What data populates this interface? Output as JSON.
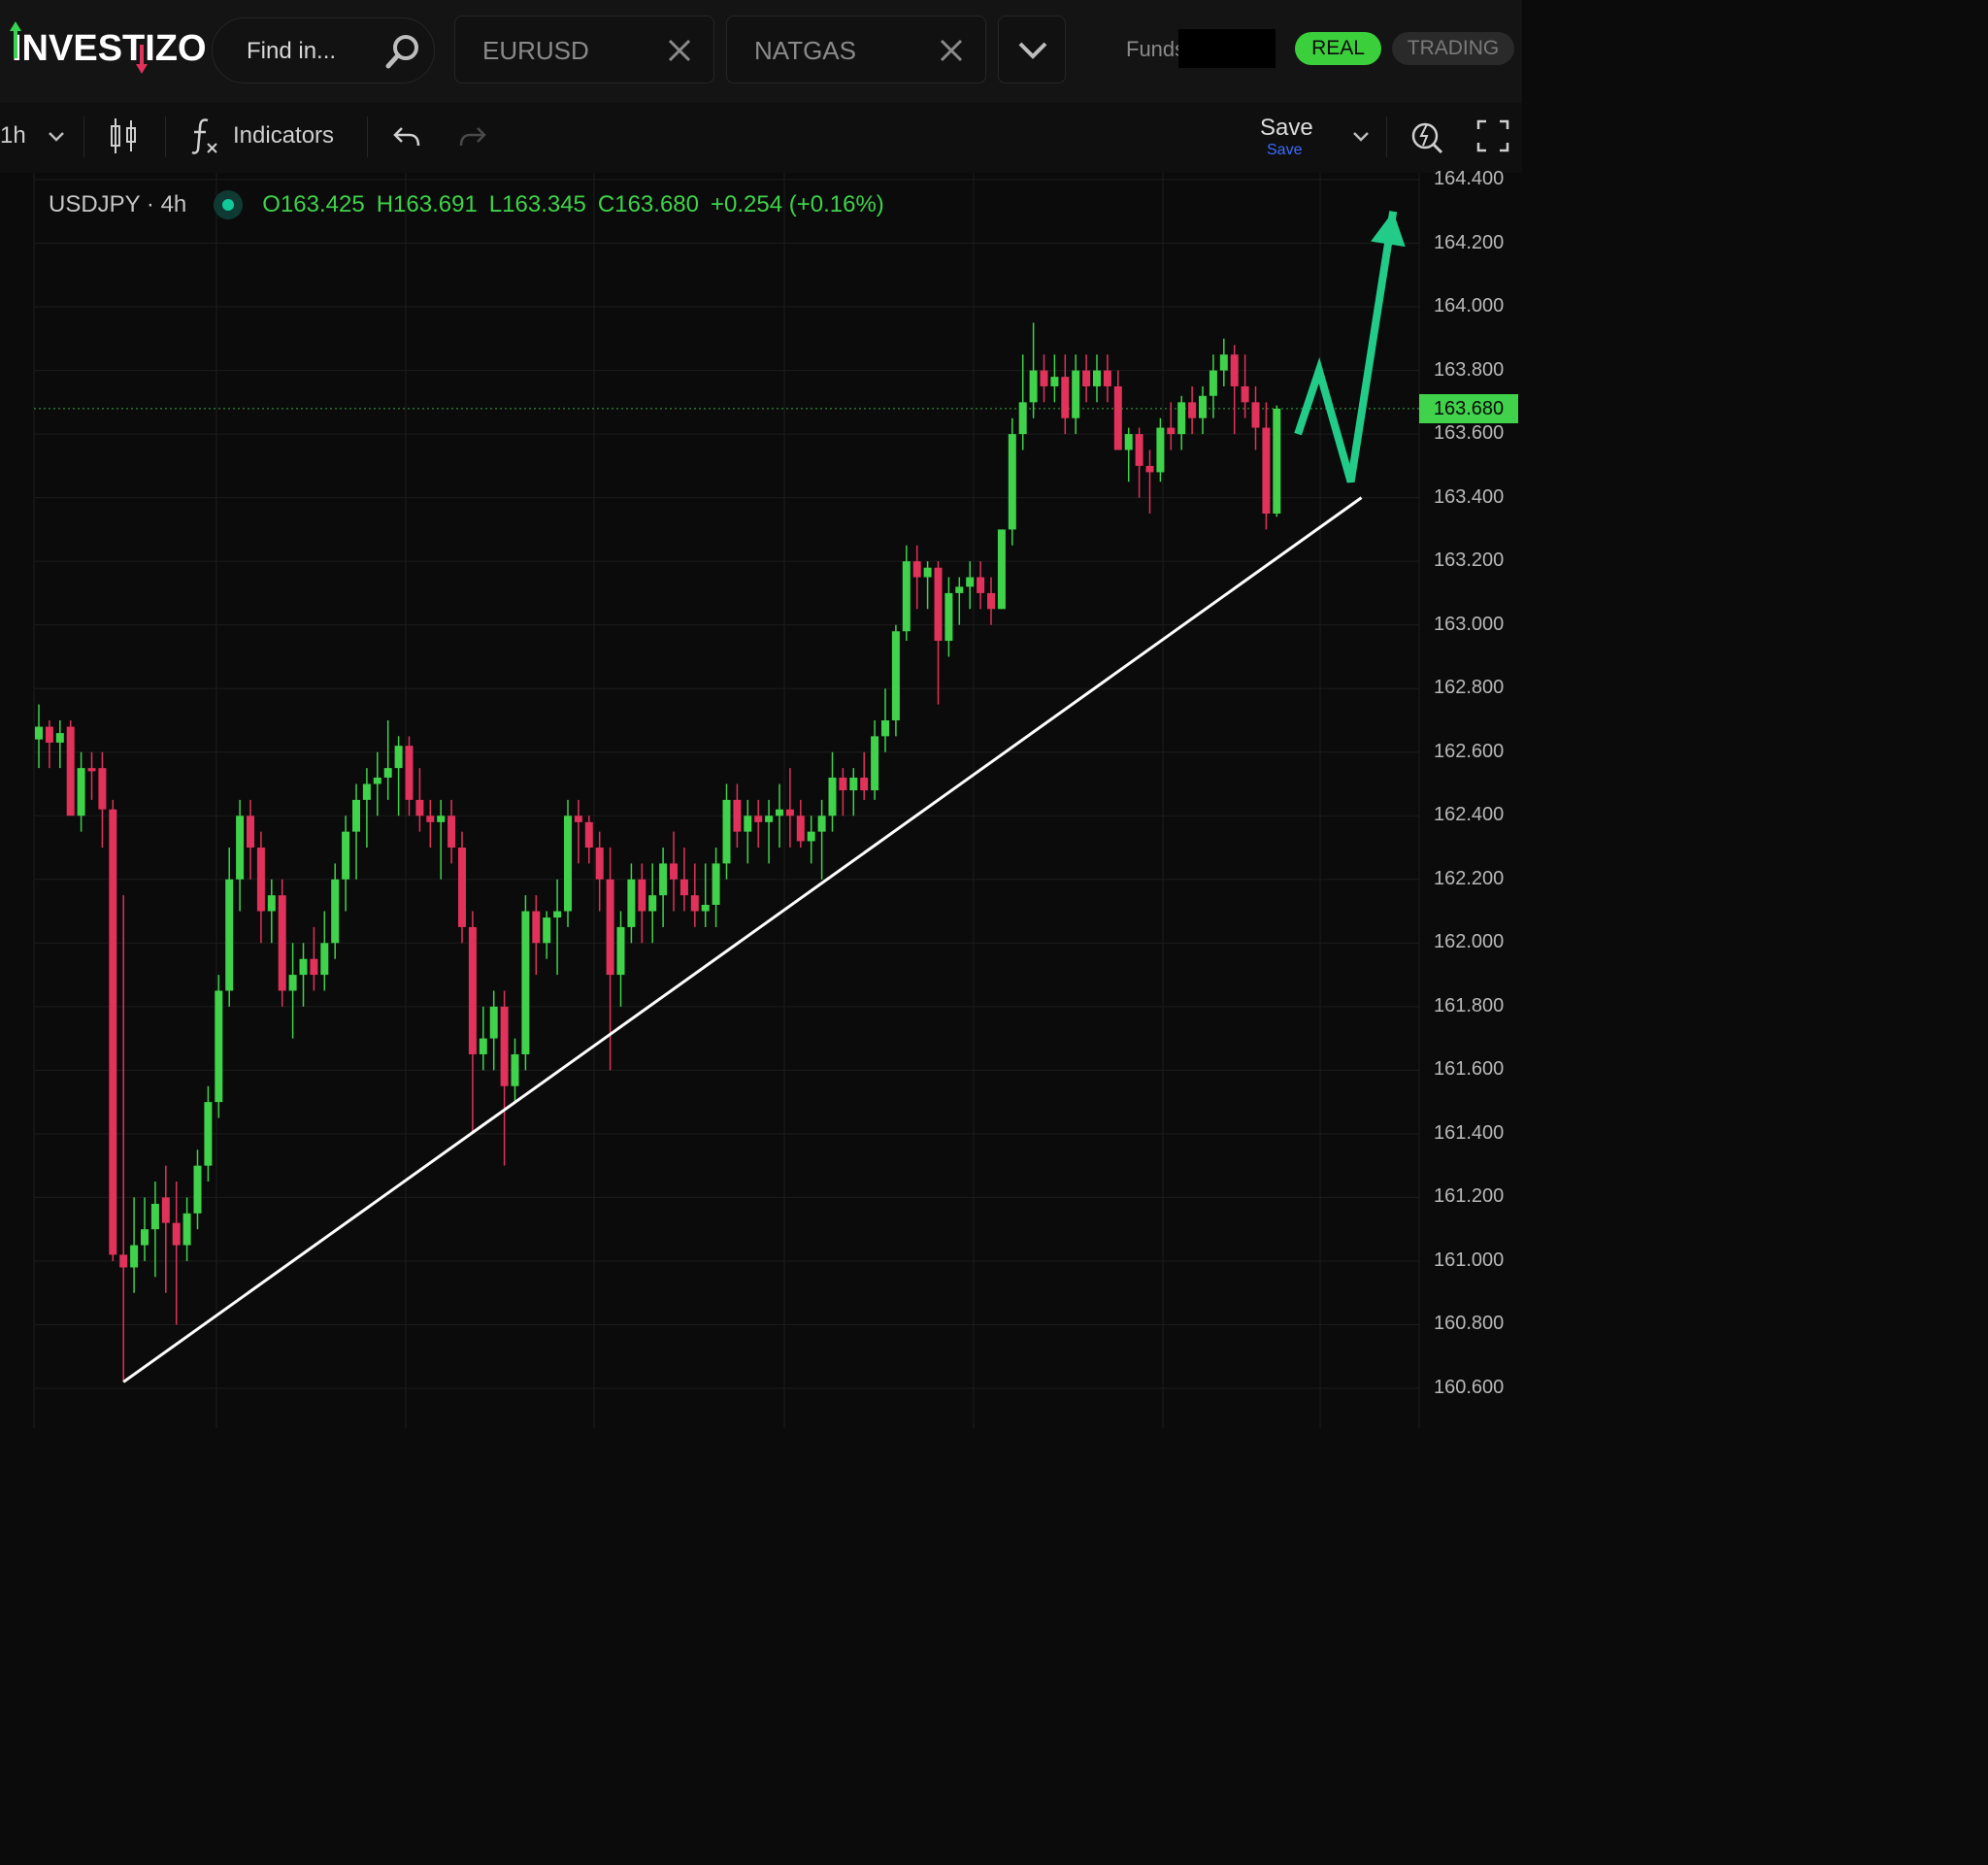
{
  "header": {
    "logo_text": "INVESTIZO",
    "search_placeholder": "Find in...",
    "tabs": [
      {
        "label": "EURUSD"
      },
      {
        "label": "NATGAS"
      }
    ],
    "funds_label": "Funds",
    "mode_real": "REAL",
    "mode_trading": "TRADING"
  },
  "toolbar": {
    "interval": "1h",
    "indicators_label": "Indicators",
    "save_label": "Save",
    "save_sub_label": "Save"
  },
  "legend": {
    "symbol": "USDJPY · 4h",
    "open": "O163.425",
    "high": "H163.691",
    "low": "L163.345",
    "close": "C163.680",
    "change": "+0.254 (+0.16%)"
  },
  "current_price": "163.680",
  "colors": {
    "up": "#3fd24a",
    "down": "#e0325a",
    "accent_green": "#3ccf3c",
    "arrow": "#22cc88",
    "trendline": "#ffffff",
    "link_blue": "#3b6cff"
  },
  "chart_data": {
    "type": "candlestick",
    "ylim": [
      160.5,
      164.4
    ],
    "y_ticks": [
      "164.400",
      "164.200",
      "164.000",
      "163.800",
      "163.600",
      "163.400",
      "163.200",
      "163.000",
      "162.800",
      "162.600",
      "162.400",
      "162.200",
      "162.000",
      "161.800",
      "161.600",
      "161.400",
      "161.200",
      "161.000",
      "160.800",
      "160.600"
    ],
    "current_price": 163.68,
    "candles": [
      {
        "o": 162.64,
        "h": 162.75,
        "l": 162.55,
        "c": 162.68
      },
      {
        "o": 162.68,
        "h": 162.7,
        "l": 162.55,
        "c": 162.63
      },
      {
        "o": 162.63,
        "h": 162.7,
        "l": 162.55,
        "c": 162.66
      },
      {
        "o": 162.68,
        "h": 162.7,
        "l": 162.5,
        "c": 162.4
      },
      {
        "o": 162.4,
        "h": 162.6,
        "l": 162.35,
        "c": 162.55
      },
      {
        "o": 162.55,
        "h": 162.6,
        "l": 162.45,
        "c": 162.54
      },
      {
        "o": 162.55,
        "h": 162.6,
        "l": 162.3,
        "c": 162.42
      },
      {
        "o": 162.42,
        "h": 162.45,
        "l": 161.0,
        "c": 161.02
      },
      {
        "o": 161.02,
        "h": 162.15,
        "l": 160.62,
        "c": 160.98
      },
      {
        "o": 160.98,
        "h": 161.2,
        "l": 160.9,
        "c": 161.05
      },
      {
        "o": 161.05,
        "h": 161.2,
        "l": 161.0,
        "c": 161.1
      },
      {
        "o": 161.1,
        "h": 161.25,
        "l": 160.95,
        "c": 161.18
      },
      {
        "o": 161.2,
        "h": 161.3,
        "l": 160.9,
        "c": 161.12
      },
      {
        "o": 161.12,
        "h": 161.25,
        "l": 160.8,
        "c": 161.05
      },
      {
        "o": 161.05,
        "h": 161.2,
        "l": 161.0,
        "c": 161.15
      },
      {
        "o": 161.15,
        "h": 161.35,
        "l": 161.1,
        "c": 161.3
      },
      {
        "o": 161.3,
        "h": 161.55,
        "l": 161.25,
        "c": 161.5
      },
      {
        "o": 161.5,
        "h": 161.9,
        "l": 161.45,
        "c": 161.85
      },
      {
        "o": 161.85,
        "h": 162.3,
        "l": 161.8,
        "c": 162.2
      },
      {
        "o": 162.2,
        "h": 162.45,
        "l": 162.1,
        "c": 162.4
      },
      {
        "o": 162.4,
        "h": 162.45,
        "l": 162.2,
        "c": 162.3
      },
      {
        "o": 162.3,
        "h": 162.35,
        "l": 162.0,
        "c": 162.1
      },
      {
        "o": 162.1,
        "h": 162.2,
        "l": 162.0,
        "c": 162.15
      },
      {
        "o": 162.15,
        "h": 162.2,
        "l": 161.8,
        "c": 161.85
      },
      {
        "o": 161.85,
        "h": 162.0,
        "l": 161.7,
        "c": 161.9
      },
      {
        "o": 161.9,
        "h": 162.0,
        "l": 161.8,
        "c": 161.95
      },
      {
        "o": 161.95,
        "h": 162.05,
        "l": 161.85,
        "c": 161.9
      },
      {
        "o": 161.9,
        "h": 162.1,
        "l": 161.85,
        "c": 162.0
      },
      {
        "o": 162.0,
        "h": 162.25,
        "l": 161.95,
        "c": 162.2
      },
      {
        "o": 162.2,
        "h": 162.4,
        "l": 162.1,
        "c": 162.35
      },
      {
        "o": 162.35,
        "h": 162.5,
        "l": 162.2,
        "c": 162.45
      },
      {
        "o": 162.45,
        "h": 162.55,
        "l": 162.3,
        "c": 162.5
      },
      {
        "o": 162.5,
        "h": 162.6,
        "l": 162.4,
        "c": 162.52
      },
      {
        "o": 162.52,
        "h": 162.7,
        "l": 162.45,
        "c": 162.55
      },
      {
        "o": 162.55,
        "h": 162.65,
        "l": 162.4,
        "c": 162.62
      },
      {
        "o": 162.62,
        "h": 162.65,
        "l": 162.4,
        "c": 162.45
      },
      {
        "o": 162.45,
        "h": 162.55,
        "l": 162.35,
        "c": 162.4
      },
      {
        "o": 162.4,
        "h": 162.45,
        "l": 162.3,
        "c": 162.38
      },
      {
        "o": 162.38,
        "h": 162.45,
        "l": 162.2,
        "c": 162.4
      },
      {
        "o": 162.4,
        "h": 162.45,
        "l": 162.25,
        "c": 162.3
      },
      {
        "o": 162.3,
        "h": 162.35,
        "l": 162.0,
        "c": 162.05
      },
      {
        "o": 162.05,
        "h": 162.1,
        "l": 161.4,
        "c": 161.65
      },
      {
        "o": 161.65,
        "h": 161.8,
        "l": 161.6,
        "c": 161.7
      },
      {
        "o": 161.7,
        "h": 161.85,
        "l": 161.6,
        "c": 161.8
      },
      {
        "o": 161.8,
        "h": 161.85,
        "l": 161.3,
        "c": 161.55
      },
      {
        "o": 161.55,
        "h": 161.7,
        "l": 161.5,
        "c": 161.65
      },
      {
        "o": 161.65,
        "h": 162.15,
        "l": 161.6,
        "c": 162.1
      },
      {
        "o": 162.1,
        "h": 162.15,
        "l": 161.9,
        "c": 162.0
      },
      {
        "o": 162.0,
        "h": 162.1,
        "l": 161.95,
        "c": 162.08
      },
      {
        "o": 162.08,
        "h": 162.2,
        "l": 161.9,
        "c": 162.1
      },
      {
        "o": 162.1,
        "h": 162.45,
        "l": 162.05,
        "c": 162.4
      },
      {
        "o": 162.4,
        "h": 162.45,
        "l": 162.25,
        "c": 162.38
      },
      {
        "o": 162.38,
        "h": 162.4,
        "l": 162.25,
        "c": 162.3
      },
      {
        "o": 162.3,
        "h": 162.35,
        "l": 162.1,
        "c": 162.2
      },
      {
        "o": 162.2,
        "h": 162.3,
        "l": 161.6,
        "c": 161.9
      },
      {
        "o": 161.9,
        "h": 162.1,
        "l": 161.8,
        "c": 162.05
      },
      {
        "o": 162.05,
        "h": 162.25,
        "l": 162.0,
        "c": 162.2
      },
      {
        "o": 162.2,
        "h": 162.25,
        "l": 162.0,
        "c": 162.1
      },
      {
        "o": 162.1,
        "h": 162.25,
        "l": 162.0,
        "c": 162.15
      },
      {
        "o": 162.15,
        "h": 162.3,
        "l": 162.05,
        "c": 162.25
      },
      {
        "o": 162.25,
        "h": 162.35,
        "l": 162.1,
        "c": 162.2
      },
      {
        "o": 162.2,
        "h": 162.3,
        "l": 162.1,
        "c": 162.15
      },
      {
        "o": 162.15,
        "h": 162.25,
        "l": 162.05,
        "c": 162.1
      },
      {
        "o": 162.1,
        "h": 162.25,
        "l": 162.05,
        "c": 162.12
      },
      {
        "o": 162.12,
        "h": 162.3,
        "l": 162.05,
        "c": 162.25
      },
      {
        "o": 162.25,
        "h": 162.5,
        "l": 162.2,
        "c": 162.45
      },
      {
        "o": 162.45,
        "h": 162.5,
        "l": 162.3,
        "c": 162.35
      },
      {
        "o": 162.35,
        "h": 162.45,
        "l": 162.25,
        "c": 162.4
      },
      {
        "o": 162.4,
        "h": 162.45,
        "l": 162.3,
        "c": 162.38
      },
      {
        "o": 162.38,
        "h": 162.45,
        "l": 162.25,
        "c": 162.4
      },
      {
        "o": 162.4,
        "h": 162.5,
        "l": 162.3,
        "c": 162.42
      },
      {
        "o": 162.42,
        "h": 162.55,
        "l": 162.3,
        "c": 162.4
      },
      {
        "o": 162.4,
        "h": 162.45,
        "l": 162.3,
        "c": 162.32
      },
      {
        "o": 162.32,
        "h": 162.4,
        "l": 162.25,
        "c": 162.35
      },
      {
        "o": 162.35,
        "h": 162.45,
        "l": 162.2,
        "c": 162.4
      },
      {
        "o": 162.4,
        "h": 162.6,
        "l": 162.35,
        "c": 162.52
      },
      {
        "o": 162.52,
        "h": 162.55,
        "l": 162.4,
        "c": 162.48
      },
      {
        "o": 162.48,
        "h": 162.55,
        "l": 162.4,
        "c": 162.52
      },
      {
        "o": 162.52,
        "h": 162.6,
        "l": 162.45,
        "c": 162.48
      },
      {
        "o": 162.48,
        "h": 162.7,
        "l": 162.45,
        "c": 162.65
      },
      {
        "o": 162.65,
        "h": 162.8,
        "l": 162.6,
        "c": 162.7
      },
      {
        "o": 162.7,
        "h": 163.0,
        "l": 162.65,
        "c": 162.98
      },
      {
        "o": 162.98,
        "h": 163.25,
        "l": 162.95,
        "c": 163.2
      },
      {
        "o": 163.2,
        "h": 163.25,
        "l": 163.05,
        "c": 163.15
      },
      {
        "o": 163.15,
        "h": 163.2,
        "l": 163.05,
        "c": 163.18
      },
      {
        "o": 163.18,
        "h": 163.2,
        "l": 162.75,
        "c": 162.95
      },
      {
        "o": 162.95,
        "h": 163.15,
        "l": 162.9,
        "c": 163.1
      },
      {
        "o": 163.1,
        "h": 163.15,
        "l": 163.0,
        "c": 163.12
      },
      {
        "o": 163.12,
        "h": 163.2,
        "l": 163.05,
        "c": 163.15
      },
      {
        "o": 163.15,
        "h": 163.2,
        "l": 163.05,
        "c": 163.1
      },
      {
        "o": 163.1,
        "h": 163.15,
        "l": 163.0,
        "c": 163.05
      },
      {
        "o": 163.05,
        "h": 163.3,
        "l": 163.05,
        "c": 163.3
      },
      {
        "o": 163.3,
        "h": 163.65,
        "l": 163.25,
        "c": 163.6
      },
      {
        "o": 163.6,
        "h": 163.85,
        "l": 163.55,
        "c": 163.7
      },
      {
        "o": 163.7,
        "h": 163.95,
        "l": 163.65,
        "c": 163.8
      },
      {
        "o": 163.8,
        "h": 163.85,
        "l": 163.7,
        "c": 163.75
      },
      {
        "o": 163.75,
        "h": 163.85,
        "l": 163.7,
        "c": 163.78
      },
      {
        "o": 163.78,
        "h": 163.85,
        "l": 163.6,
        "c": 163.65
      },
      {
        "o": 163.65,
        "h": 163.85,
        "l": 163.6,
        "c": 163.8
      },
      {
        "o": 163.8,
        "h": 163.85,
        "l": 163.7,
        "c": 163.75
      },
      {
        "o": 163.75,
        "h": 163.85,
        "l": 163.7,
        "c": 163.8
      },
      {
        "o": 163.8,
        "h": 163.85,
        "l": 163.7,
        "c": 163.75
      },
      {
        "o": 163.75,
        "h": 163.8,
        "l": 163.6,
        "c": 163.55
      },
      {
        "o": 163.55,
        "h": 163.62,
        "l": 163.45,
        "c": 163.6
      },
      {
        "o": 163.6,
        "h": 163.62,
        "l": 163.4,
        "c": 163.5
      },
      {
        "o": 163.5,
        "h": 163.55,
        "l": 163.35,
        "c": 163.48
      },
      {
        "o": 163.48,
        "h": 163.65,
        "l": 163.45,
        "c": 163.62
      },
      {
        "o": 163.62,
        "h": 163.7,
        "l": 163.55,
        "c": 163.6
      },
      {
        "o": 163.6,
        "h": 163.72,
        "l": 163.55,
        "c": 163.7
      },
      {
        "o": 163.7,
        "h": 163.75,
        "l": 163.6,
        "c": 163.65
      },
      {
        "o": 163.65,
        "h": 163.75,
        "l": 163.6,
        "c": 163.72
      },
      {
        "o": 163.72,
        "h": 163.85,
        "l": 163.65,
        "c": 163.8
      },
      {
        "o": 163.8,
        "h": 163.9,
        "l": 163.75,
        "c": 163.85
      },
      {
        "o": 163.85,
        "h": 163.88,
        "l": 163.6,
        "c": 163.75
      },
      {
        "o": 163.75,
        "h": 163.85,
        "l": 163.65,
        "c": 163.7
      },
      {
        "o": 163.7,
        "h": 163.75,
        "l": 163.55,
        "c": 163.62
      },
      {
        "o": 163.62,
        "h": 163.7,
        "l": 163.3,
        "c": 163.35
      },
      {
        "o": 163.35,
        "h": 163.69,
        "l": 163.34,
        "c": 163.68
      }
    ],
    "trendline": [
      {
        "x": 8,
        "y": 160.62
      },
      {
        "x": 125,
        "y": 163.4
      }
    ],
    "projection_arrow": [
      {
        "x": 119,
        "y": 163.6
      },
      {
        "x": 121,
        "y": 163.8
      },
      {
        "x": 124,
        "y": 163.45
      },
      {
        "x": 128,
        "y": 164.3
      }
    ]
  }
}
